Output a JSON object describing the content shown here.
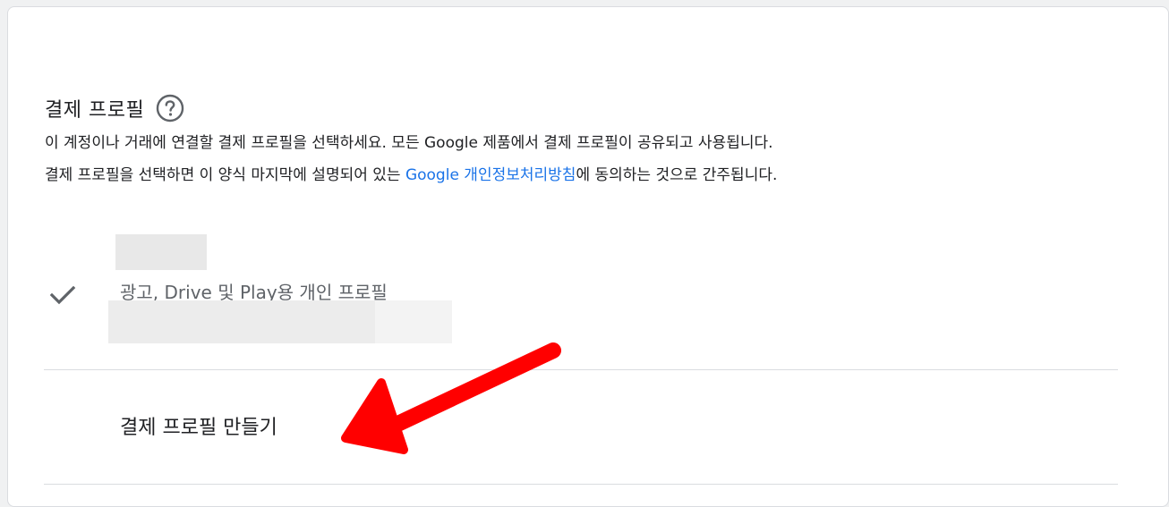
{
  "section": {
    "title": "결제 프로필",
    "help_icon": "help-circle-icon",
    "description_line1": "이 계정이나 거래에 연결할 결제 프로필을 선택하세요. 모든 Google 제품에서 결제 프로필이 공유되고 사용됩니다.",
    "description_line2_before": "결제 프로필을 선택하면 이 양식 마지막에 설명되어 있는 ",
    "privacy_link": "Google 개인정보처리방침",
    "description_line2_after": "에 동의하는 것으로 간주됩니다."
  },
  "profile": {
    "label": "광고, Drive 및 Play용 개인 프로필",
    "check_icon": "check-icon",
    "selected": true
  },
  "create": {
    "label": "결제 프로필 만들기"
  },
  "annotation": {
    "arrow_color": "#ff0000",
    "icon": "red-arrow-icon"
  },
  "colors": {
    "link": "#1a73e8",
    "text": "#202124",
    "muted": "#5f6368",
    "divider": "#dadce0"
  }
}
